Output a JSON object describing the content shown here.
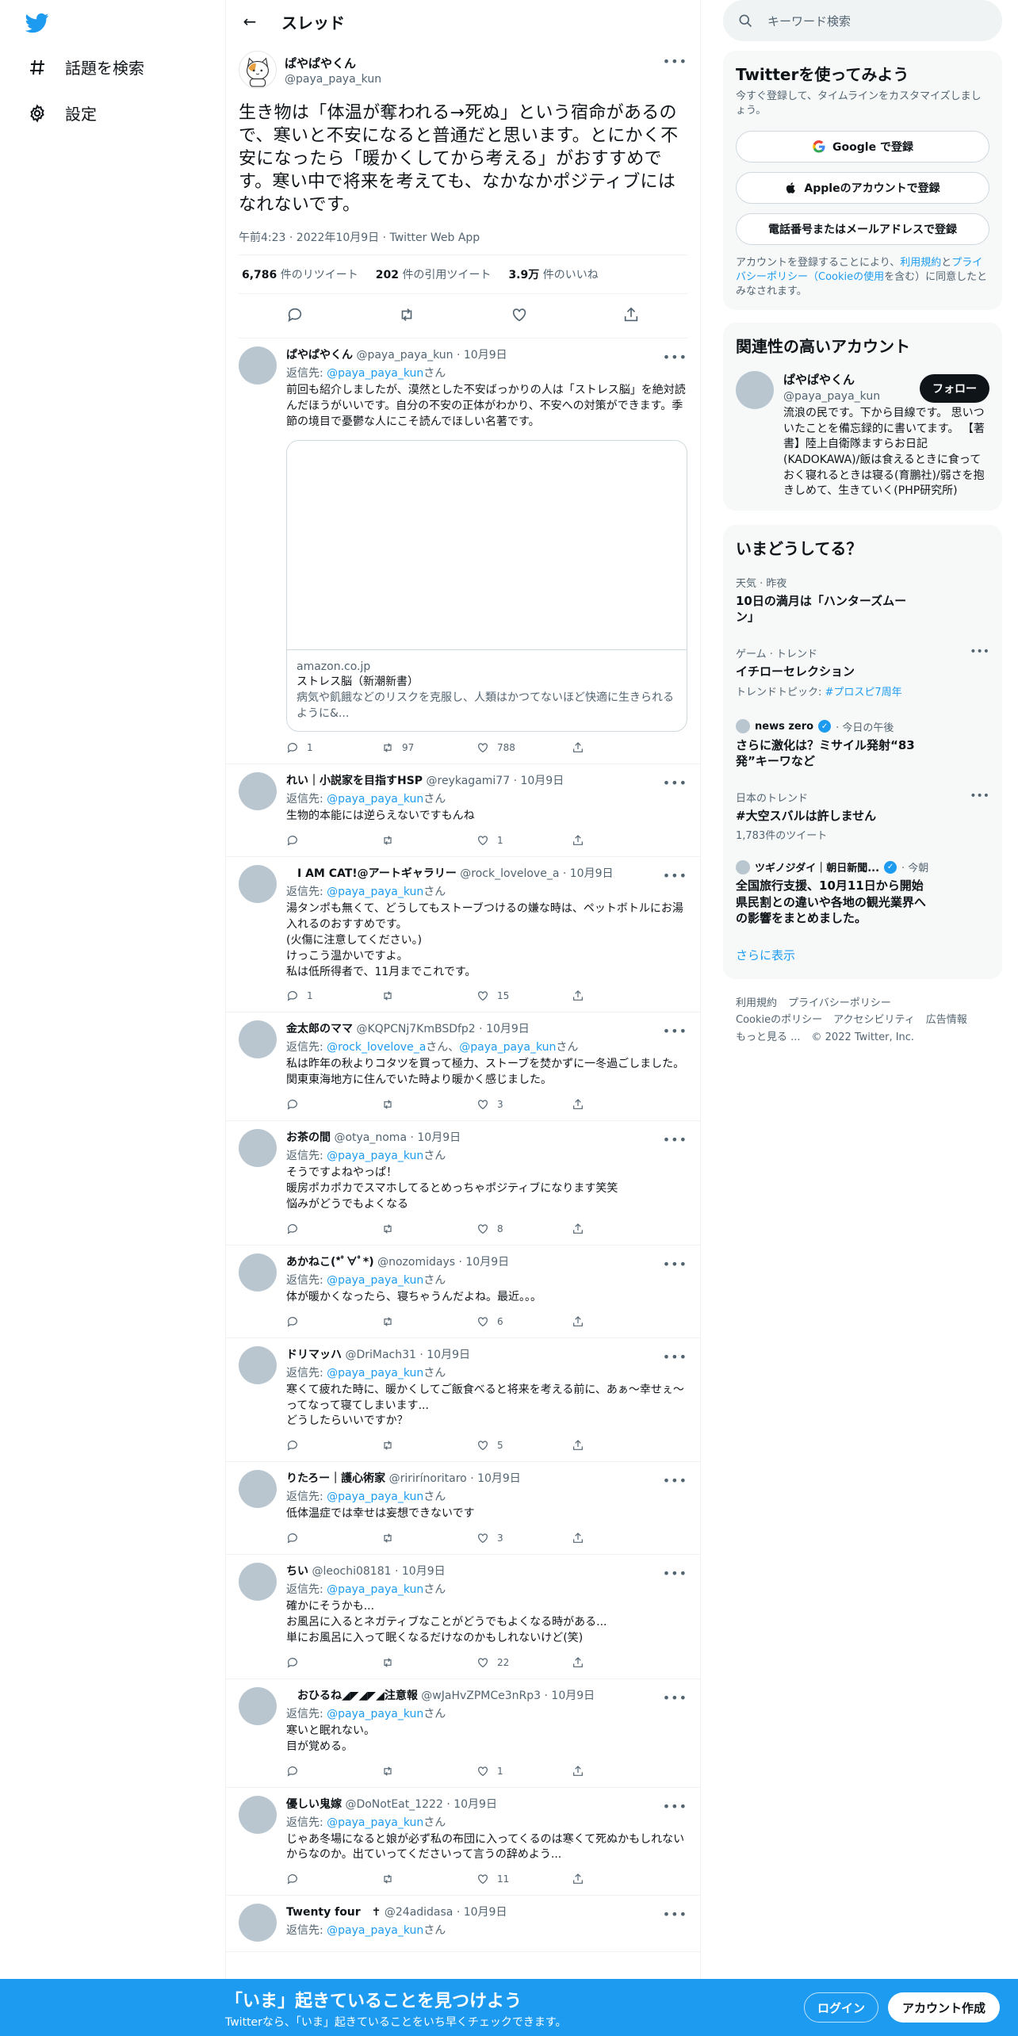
{
  "colors": {
    "accent": "#1d9bf0",
    "text": "#0f1419",
    "muted": "#536471",
    "bottom_bar": "#1d9bf0"
  },
  "nav": {
    "logo_icon": "twitter-bird-icon",
    "items": [
      {
        "label": "話題を検索",
        "icon": "hashtag-icon"
      },
      {
        "label": "設定",
        "icon": "gear-icon"
      }
    ]
  },
  "header": {
    "title": "スレッド",
    "back_icon": "arrow-left-icon"
  },
  "main_tweet": {
    "name": "ぱやぱやくん",
    "handle": "@paya_paya_kun",
    "text": "生き物は「体温が奪われる→死ぬ」という宿命があるので、寒いと不安になると普通だと思います。とにかく不安になったら「暖かくしてから考える」がおすすめです。寒い中で将来を考えても、なかなかポジティブにはなれないです。",
    "time": "午前4:23 · 2022年10月9日 · Twitter Web App",
    "stats": {
      "retweets": "6,786",
      "retweets_label": "件のリツイート",
      "quotes": "202",
      "quotes_label": "件の引用ツイート",
      "likes": "3.9万",
      "likes_label": "件のいいね"
    }
  },
  "replies": [
    {
      "name": "ぱやぱやくん",
      "handle": "@paya_paya_kun",
      "date": "· 10月9日",
      "reply_prefix": "返信先: ",
      "reply_to": "@paya_paya_kun",
      "reply_suffix": "さん",
      "text": "前回も紹介しましたが、漠然とした不安ばっかりの人は「ストレス脳」を絶対読んだほうがいいです。自分の不安の正体がわかり、不安への対策ができます。季節の境目で憂鬱な人にこそ読んでほしい名著です。",
      "card": {
        "domain": "amazon.co.jp",
        "title": "ストレス脳（新潮新書）",
        "desc": "病気や飢餓などのリスクを克服し、人類はかつてないほど快適に生きられるように&..."
      },
      "counts": {
        "reply": "1",
        "retweet": "97",
        "like": "788"
      }
    },
    {
      "name": "れい｜小説家を目指すHSP",
      "handle": "@reykagami77",
      "date": "· 10月9日",
      "reply_prefix": "返信先: ",
      "reply_to": "@paya_paya_kun",
      "reply_suffix": "さん",
      "text": "生物的本能には逆らえないですもんね",
      "counts": {
        "reply": "",
        "retweet": "",
        "like": "1"
      }
    },
    {
      "name": "　I AM CAT!@アートギャラリー",
      "handle": "@rock_lovelove_a",
      "date": "· 10月9日",
      "reply_prefix": "返信先: ",
      "reply_to": "@paya_paya_kun",
      "reply_suffix": "さん",
      "text": "湯タンポも無くて、どうしてもストーブつけるの嫌な時は、ペットボトルにお湯入れるのおすすめです。\n(火傷に注意してください。)\nけっこう温かいですよ。\n私は低所得者で、11月までこれです。",
      "counts": {
        "reply": "1",
        "retweet": "",
        "like": "15"
      }
    },
    {
      "name": "金太郎のママ",
      "handle": "@KQPCNj7KmBSDfp2",
      "date": "· 10月9日",
      "reply_prefix": "返信先: ",
      "reply_to": "@rock_lovelove_a",
      "reply_mid": "さん、",
      "reply_to2": "@paya_paya_kun",
      "reply_suffix": "さん",
      "text": "私は昨年の秋よりコタツを買って極力、ストーブを焚かずに一冬過ごしました。関東東海地方に住んでいた時より暖かく感じました。",
      "counts": {
        "reply": "",
        "retweet": "",
        "like": "3"
      }
    },
    {
      "name": "お茶の間",
      "handle": "@otya_noma",
      "date": "· 10月9日",
      "reply_prefix": "返信先: ",
      "reply_to": "@paya_paya_kun",
      "reply_suffix": "さん",
      "text": "そうですよねやっぱ！\n暖房ポカポカでスマホしてるとめっちゃポジティブになります笑笑\n悩みがどうでもよくなる",
      "counts": {
        "reply": "",
        "retweet": "",
        "like": "8"
      }
    },
    {
      "name": "あかねこ(*ﾟ∀ﾟ*)",
      "handle": "@nozomidays",
      "date": "· 10月9日",
      "reply_prefix": "返信先: ",
      "reply_to": "@paya_paya_kun",
      "reply_suffix": "さん",
      "text": "体が暖かくなったら、寝ちゃうんだよね。最近。。。",
      "counts": {
        "reply": "",
        "retweet": "",
        "like": "6"
      }
    },
    {
      "name": "ドリマッハ",
      "handle": "@DriMach31",
      "date": "· 10月9日",
      "reply_prefix": "返信先: ",
      "reply_to": "@paya_paya_kun",
      "reply_suffix": "さん",
      "text": "寒くて疲れた時に、暖かくしてご飯食べると将来を考える前に、あぁ〜幸せぇ〜ってなって寝てしまいます...\nどうしたらいいですか？",
      "counts": {
        "reply": "",
        "retweet": "",
        "like": "5"
      }
    },
    {
      "name": "りたろー｜護心術家",
      "handle": "@ririrínoritaro",
      "date": "· 10月9日",
      "reply_prefix": "返信先: ",
      "reply_to": "@paya_paya_kun",
      "reply_suffix": "さん",
      "text": "低体温症では幸せは妄想できないです",
      "counts": {
        "reply": "",
        "retweet": "",
        "like": "3"
      }
    },
    {
      "name": "ちい",
      "handle": "@leochi08181",
      "date": "· 10月9日",
      "reply_prefix": "返信先: ",
      "reply_to": "@paya_paya_kun",
      "reply_suffix": "さん",
      "text": "確かにそうかも...\nお風呂に入るとネガティブなことがどうでもよくなる時がある...\n単にお風呂に入って眠くなるだけなのかもしれないけど(笑)",
      "counts": {
        "reply": "",
        "retweet": "",
        "like": "22"
      }
    },
    {
      "name": "　おひるね◢◤◢◤◢注意報",
      "handle": "@wJaHvZPMCe3nRp3",
      "date": "· 10月9日",
      "reply_prefix": "返信先: ",
      "reply_to": "@paya_paya_kun",
      "reply_suffix": "さん",
      "text": "寒いと眠れない。\n目が覚める。",
      "counts": {
        "reply": "",
        "retweet": "",
        "like": "1"
      }
    },
    {
      "name": "優しい鬼嫁",
      "handle": "@DoNotEat_1222",
      "date": "· 10月9日",
      "reply_prefix": "返信先: ",
      "reply_to": "@paya_paya_kun",
      "reply_suffix": "さん",
      "text": "じゃあ冬場になると娘が必ず私の布団に入ってくるのは寒くて死ぬかもしれないからなのか。出ていってくださいって言うの辞めよう...",
      "counts": {
        "reply": "",
        "retweet": "",
        "like": "11"
      }
    },
    {
      "name": "Twenty four　✝",
      "handle": "@24adidasa",
      "date": "· 10月9日",
      "reply_prefix": "返信先: ",
      "reply_to": "@paya_paya_kun",
      "reply_suffix": "さん",
      "text": "",
      "counts": {
        "reply": "",
        "retweet": "",
        "like": ""
      }
    }
  ],
  "sidebar": {
    "search_placeholder": "キーワード検索",
    "signup": {
      "title": "Twitterを使ってみよう",
      "subtitle": "今すぐ登録して、タイムラインをカスタマイズしましょう。",
      "google": "Google で登録",
      "apple": "Appleのアカウントで登録",
      "email": "電話番号またはメールアドレスで登録",
      "legal_prefix": "アカウントを登録することにより、",
      "legal_terms": "利用規約",
      "legal_and": "と",
      "legal_privacy": "プライバシーポリシー",
      "legal_cookie": "（Cookieの使用",
      "legal_suffix": "を含む）に同意したとみなされます。"
    },
    "related": {
      "title": "関連性の高いアカウント",
      "name": "ぱやぱやくん",
      "handle": "@paya_paya_kun",
      "follow": "フォロー",
      "bio": "流浪の民です。下から目線です。 思いついたことを備忘録的に書いてます。 【著書】陸上自衛隊ますらお日記(KADOKAWA)/飯は食えるときに食っておく寝れるときは寝る(育鵬社)/弱さを抱きしめて、生きていく(PHP研究所)"
    },
    "trends": {
      "title": "いまどうしてる？",
      "items": [
        {
          "category": "天気 · 昨夜",
          "title": "10日の満月は「ハンターズムーン」"
        },
        {
          "category": "ゲーム · トレンド",
          "title": "イチローセレクション",
          "extra_prefix": "トレンドトピック: ",
          "extra_link": "#プロスピ7周年"
        },
        {
          "source": "news zero",
          "source_time": "· 今日の午後",
          "title": "さらに激化は？ミサイル発射“83発”キーワなど"
        },
        {
          "category": "日本のトレンド",
          "title": "#大空スバルは許しません",
          "extra": "1,783件のツイート"
        },
        {
          "source": "ツギノジダイ｜朝日新聞...",
          "source_time": "· 今朝",
          "title": "全国旅行支援、10月11日から開始 県民割との違いや各地の観光業界への影響をまとめました。"
        }
      ],
      "show_more": "さらに表示"
    },
    "footer": {
      "line1": [
        "利用規約",
        "プライバシーポリシー"
      ],
      "line2": [
        "Cookieのポリシー",
        "アクセシビリティ",
        "広告情報"
      ],
      "line3": [
        "もっと見る ...",
        "© 2022 Twitter, Inc."
      ]
    }
  },
  "bottom_bar": {
    "title": "「いま」起きていることを見つけよう",
    "subtitle": "Twitterなら、「いま」起きていることをいち早くチェックできます。",
    "login": "ログイン",
    "signup": "アカウント作成"
  }
}
